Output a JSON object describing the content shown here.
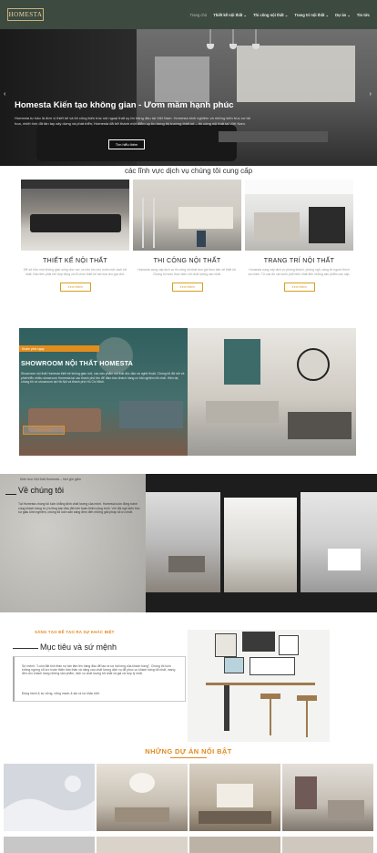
{
  "nav": {
    "logo": "HOMESTA",
    "items": [
      {
        "label": "Trang chủ"
      },
      {
        "label": "Thiết kế nội thất ⌄"
      },
      {
        "label": "Thi công nội thất ⌄"
      },
      {
        "label": "Trang trí nội thất ⌄"
      },
      {
        "label": "Dự án ⌄"
      },
      {
        "label": "Tin tức"
      }
    ]
  },
  "hero": {
    "title": "Homesta Kiến tạo không gian - Ươm mầm hạnh phúc",
    "text": "Homesta tự hào là đơn vị thiết kế và thi công kiến trúc nội ngoại thất uy tín hàng đầu tại Việt Nam. Homesta kinh nghiệm và những kiến trúc sư tài hoa, nhiệt tình đã tận tay xây dựng và phát triển, Homesta đã trở thành một điểm uy tín trong thị trường thiết kế – thi công nội thất tại Việt Nam.",
    "button": "Tìm hiểu thêm"
  },
  "services": {
    "title": "các lĩnh vực dịch vụ chúng tôi cung cấp",
    "items": [
      {
        "title": "THIẾT KẾ NỘI THẤT",
        "text": "Để sở hữu một không gian sống như mơ, ta nên tìm cho mình một cách tốt nhất. Đầu tiên phải kết hợp đúng và tổ chức thiết kế hài hòa cho gia chủ.",
        "button": "Xem thêm"
      },
      {
        "title": "THI CÔNG NỘI THẤT",
        "text": "Homesta cung cấp dịch vụ thi công nội thất trọn gói theo bản vẽ thiết kế. Chúng tôi luôn thực hiện với chất lượng cao nhất.",
        "button": "Xem thêm"
      },
      {
        "title": "TRANG TRÍ NỘI THẤT",
        "text": "Homesta cung cấp dịch vụ phòng khách, phòng ngủ, căng tin người thích sưu tầm. Từ các đồ vật cuốn phổ biến nhất đến những sản phẩm cao cấp.",
        "button": "Xem thêm"
      }
    ]
  },
  "showroom": {
    "tag": "Khám phá ngay",
    "title": "SHOWROOM NỘI THẤT HOMESTA",
    "text": "Showroom nội thất Homesta thiết kế không gian mở, các sản phẩm nội thất độc đáo và nghệ thuật. Chúng tôi đã mở và phát triển nhiều showroom Homesta tại các thành phố lớn để đảm bảo khách hàng có trải nghiệm tốt nhất. Hiện tại, chúng tôi có showroom tại Hà Nội và thành phố Hồ Chí Minh.",
    "button": "Xem thêm"
  },
  "about": {
    "tag": "Kiến trúc Nội thất Homesta – Nơi gửi gắm",
    "title": "Về chúng tôi",
    "text": "Tại Homesta chúng tôi luôn khẳng định chất lượng của mình. Homesta luôn đồng hành cùng khách hàng từ ý tưởng ban đầu đến khi hoàn thiện công trình. Với đội ngũ kiến trúc sư giàu kinh nghiệm, chúng tôi luôn sẵn sàng đem đến những giải pháp tối ưu nhất."
  },
  "mission": {
    "tag": "SÁNG TẠO ĐỂ TẠO RA SỰ KHÁC BIỆT",
    "title": "Mục tiêu và sứ mệnh",
    "text": "Sứ mệnh: \"Luôn đặt tinh thần sự tận tâm lên hàng đầu để tạo ra sự hài lòng của khách hàng\". Chúng tôi luôn không ngừng nỗ lực hoàn thiện bản thân và nâng cao chất lượng dịch vụ để phục vụ khách hàng tốt nhất, mang đến cho khách hàng những sản phẩm, dịch vụ chất lượng tốt nhất và giá cả hợp lý nhất.",
    "line2": "Đồng hành & sự vững, vững mạnh & tạo ra sự khác biệt."
  },
  "projects": {
    "title": "NHỮNG DỰ ÁN NỔI BẬT"
  },
  "colors": {
    "nav_bg": "#3d4a40",
    "accent": "#e08a1e",
    "teal": "#3c6e6c"
  },
  "icons": [
    "chevron-left-icon",
    "chevron-right-icon",
    "image-placeholder-icon"
  ]
}
